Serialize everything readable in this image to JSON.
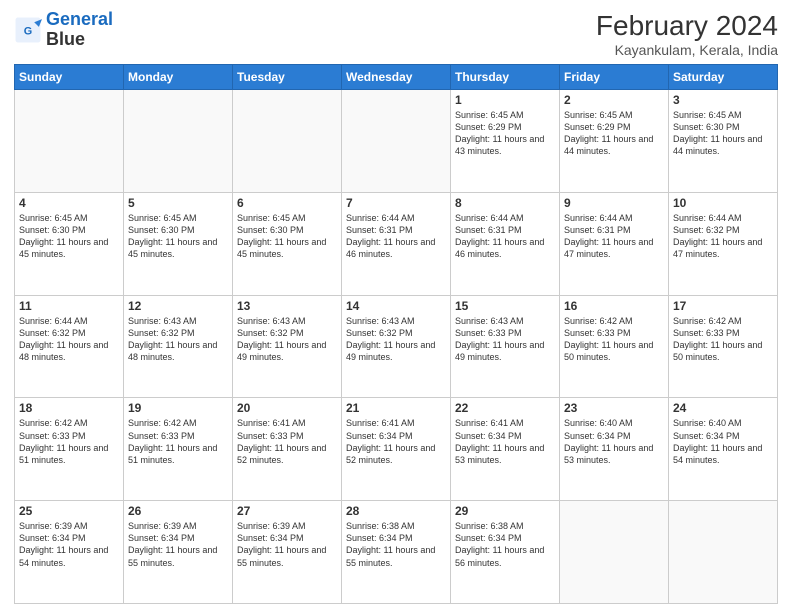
{
  "logo": {
    "line1": "General",
    "line2": "Blue"
  },
  "title": "February 2024",
  "location": "Kayankulam, Kerala, India",
  "days_of_week": [
    "Sunday",
    "Monday",
    "Tuesday",
    "Wednesday",
    "Thursday",
    "Friday",
    "Saturday"
  ],
  "weeks": [
    [
      {
        "num": "",
        "info": ""
      },
      {
        "num": "",
        "info": ""
      },
      {
        "num": "",
        "info": ""
      },
      {
        "num": "",
        "info": ""
      },
      {
        "num": "1",
        "info": "Sunrise: 6:45 AM\nSunset: 6:29 PM\nDaylight: 11 hours\nand 43 minutes."
      },
      {
        "num": "2",
        "info": "Sunrise: 6:45 AM\nSunset: 6:29 PM\nDaylight: 11 hours\nand 44 minutes."
      },
      {
        "num": "3",
        "info": "Sunrise: 6:45 AM\nSunset: 6:30 PM\nDaylight: 11 hours\nand 44 minutes."
      }
    ],
    [
      {
        "num": "4",
        "info": "Sunrise: 6:45 AM\nSunset: 6:30 PM\nDaylight: 11 hours\nand 45 minutes."
      },
      {
        "num": "5",
        "info": "Sunrise: 6:45 AM\nSunset: 6:30 PM\nDaylight: 11 hours\nand 45 minutes."
      },
      {
        "num": "6",
        "info": "Sunrise: 6:45 AM\nSunset: 6:30 PM\nDaylight: 11 hours\nand 45 minutes."
      },
      {
        "num": "7",
        "info": "Sunrise: 6:44 AM\nSunset: 6:31 PM\nDaylight: 11 hours\nand 46 minutes."
      },
      {
        "num": "8",
        "info": "Sunrise: 6:44 AM\nSunset: 6:31 PM\nDaylight: 11 hours\nand 46 minutes."
      },
      {
        "num": "9",
        "info": "Sunrise: 6:44 AM\nSunset: 6:31 PM\nDaylight: 11 hours\nand 47 minutes."
      },
      {
        "num": "10",
        "info": "Sunrise: 6:44 AM\nSunset: 6:32 PM\nDaylight: 11 hours\nand 47 minutes."
      }
    ],
    [
      {
        "num": "11",
        "info": "Sunrise: 6:44 AM\nSunset: 6:32 PM\nDaylight: 11 hours\nand 48 minutes."
      },
      {
        "num": "12",
        "info": "Sunrise: 6:43 AM\nSunset: 6:32 PM\nDaylight: 11 hours\nand 48 minutes."
      },
      {
        "num": "13",
        "info": "Sunrise: 6:43 AM\nSunset: 6:32 PM\nDaylight: 11 hours\nand 49 minutes."
      },
      {
        "num": "14",
        "info": "Sunrise: 6:43 AM\nSunset: 6:32 PM\nDaylight: 11 hours\nand 49 minutes."
      },
      {
        "num": "15",
        "info": "Sunrise: 6:43 AM\nSunset: 6:33 PM\nDaylight: 11 hours\nand 49 minutes."
      },
      {
        "num": "16",
        "info": "Sunrise: 6:42 AM\nSunset: 6:33 PM\nDaylight: 11 hours\nand 50 minutes."
      },
      {
        "num": "17",
        "info": "Sunrise: 6:42 AM\nSunset: 6:33 PM\nDaylight: 11 hours\nand 50 minutes."
      }
    ],
    [
      {
        "num": "18",
        "info": "Sunrise: 6:42 AM\nSunset: 6:33 PM\nDaylight: 11 hours\nand 51 minutes."
      },
      {
        "num": "19",
        "info": "Sunrise: 6:42 AM\nSunset: 6:33 PM\nDaylight: 11 hours\nand 51 minutes."
      },
      {
        "num": "20",
        "info": "Sunrise: 6:41 AM\nSunset: 6:33 PM\nDaylight: 11 hours\nand 52 minutes."
      },
      {
        "num": "21",
        "info": "Sunrise: 6:41 AM\nSunset: 6:34 PM\nDaylight: 11 hours\nand 52 minutes."
      },
      {
        "num": "22",
        "info": "Sunrise: 6:41 AM\nSunset: 6:34 PM\nDaylight: 11 hours\nand 53 minutes."
      },
      {
        "num": "23",
        "info": "Sunrise: 6:40 AM\nSunset: 6:34 PM\nDaylight: 11 hours\nand 53 minutes."
      },
      {
        "num": "24",
        "info": "Sunrise: 6:40 AM\nSunset: 6:34 PM\nDaylight: 11 hours\nand 54 minutes."
      }
    ],
    [
      {
        "num": "25",
        "info": "Sunrise: 6:39 AM\nSunset: 6:34 PM\nDaylight: 11 hours\nand 54 minutes."
      },
      {
        "num": "26",
        "info": "Sunrise: 6:39 AM\nSunset: 6:34 PM\nDaylight: 11 hours\nand 55 minutes."
      },
      {
        "num": "27",
        "info": "Sunrise: 6:39 AM\nSunset: 6:34 PM\nDaylight: 11 hours\nand 55 minutes."
      },
      {
        "num": "28",
        "info": "Sunrise: 6:38 AM\nSunset: 6:34 PM\nDaylight: 11 hours\nand 55 minutes."
      },
      {
        "num": "29",
        "info": "Sunrise: 6:38 AM\nSunset: 6:34 PM\nDaylight: 11 hours\nand 56 minutes."
      },
      {
        "num": "",
        "info": ""
      },
      {
        "num": "",
        "info": ""
      }
    ]
  ]
}
